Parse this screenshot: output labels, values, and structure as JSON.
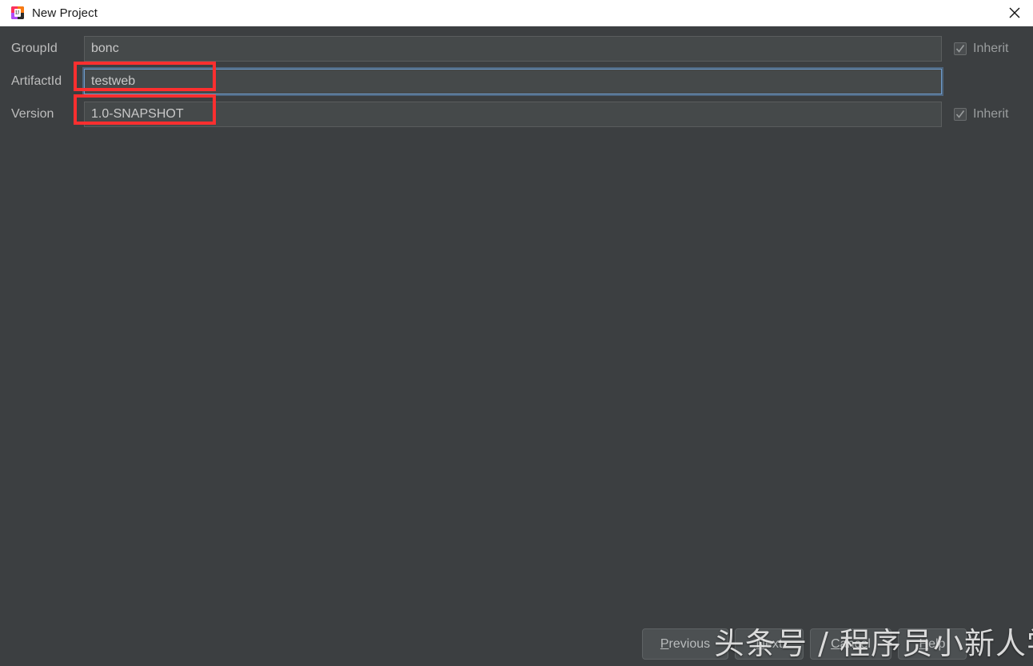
{
  "window": {
    "title": "New Project",
    "app_icon": "intellij-idea-icon",
    "close_icon": "close-icon",
    "background_color": "#3c3f41",
    "titlebar_color": "#ffffff",
    "accent_color": "#1f5f63"
  },
  "form": {
    "fields": [
      {
        "label": "GroupId",
        "value": "bonc",
        "placeholder": "",
        "focused": false,
        "annotated": true,
        "inherit": {
          "label": "Inherit",
          "checked": true,
          "enabled": false
        }
      },
      {
        "label": "ArtifactId",
        "value": "testweb",
        "placeholder": "",
        "focused": true,
        "annotated": true,
        "inherit": null
      },
      {
        "label": "Version",
        "value": "1.0-SNAPSHOT",
        "placeholder": "",
        "focused": false,
        "annotated": false,
        "inherit": {
          "label": "Inherit",
          "checked": true,
          "enabled": false
        }
      }
    ]
  },
  "annotations": {
    "color": "#fc2f2f",
    "boxes": [
      {
        "target": "groupid-input"
      },
      {
        "target": "artifactid-input"
      }
    ]
  },
  "buttons": {
    "previous": {
      "mnemonic": "P",
      "rest": "revious"
    },
    "next": {
      "mnemonic": "N",
      "rest": "ext"
    },
    "cancel": {
      "mnemonic": "C",
      "rest": "ancel"
    },
    "help": {
      "mnemonic": "H",
      "rest": "elp"
    }
  },
  "watermark": {
    "text": "头条号 / 程序员小新人学习"
  }
}
